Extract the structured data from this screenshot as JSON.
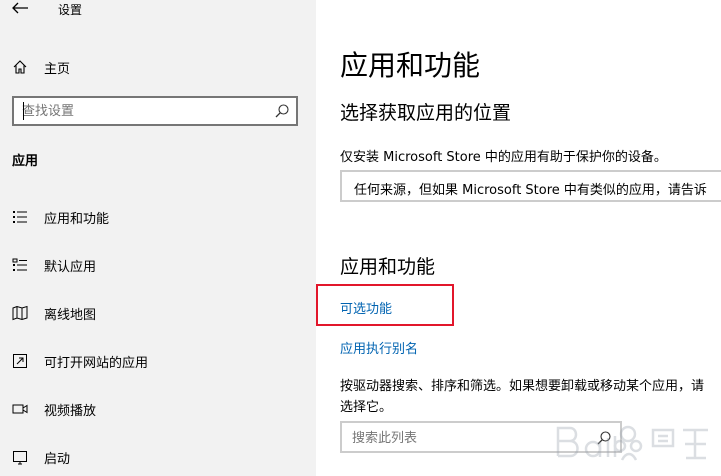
{
  "window": {
    "title": "设置"
  },
  "sidebar": {
    "home_label": "主页",
    "search_placeholder": "查找设置",
    "section_title": "应用",
    "items": [
      {
        "label": "应用和功能",
        "icon": "list-icon"
      },
      {
        "label": "默认应用",
        "icon": "default-apps-icon"
      },
      {
        "label": "离线地图",
        "icon": "map-icon"
      },
      {
        "label": "可打开网站的应用",
        "icon": "open-external-icon"
      },
      {
        "label": "视频播放",
        "icon": "video-icon"
      },
      {
        "label": "启动",
        "icon": "startup-icon"
      }
    ]
  },
  "main": {
    "title": "应用和功能",
    "install_section": {
      "heading": "选择获取应用的位置",
      "description": "仅安装 Microsoft Store 中的应用有助于保护你的设备。",
      "dropdown_value": "任何来源，但如果 Microsoft Store 中有类似的应用，请告诉"
    },
    "apps_section": {
      "heading": "应用和功能",
      "link_optional_features": "可选功能",
      "link_app_aliases": "应用执行别名",
      "description_line1": "按驱动器搜索、排序和筛选。如果想要卸载或移动某个应用，请",
      "description_line2": "选择它。",
      "search_placeholder": "搜索此列表"
    }
  },
  "annotation": {
    "highlight_color": "#e2162b"
  },
  "colors": {
    "sidebar_bg": "#f2f2f2",
    "link": "#0063b1"
  }
}
